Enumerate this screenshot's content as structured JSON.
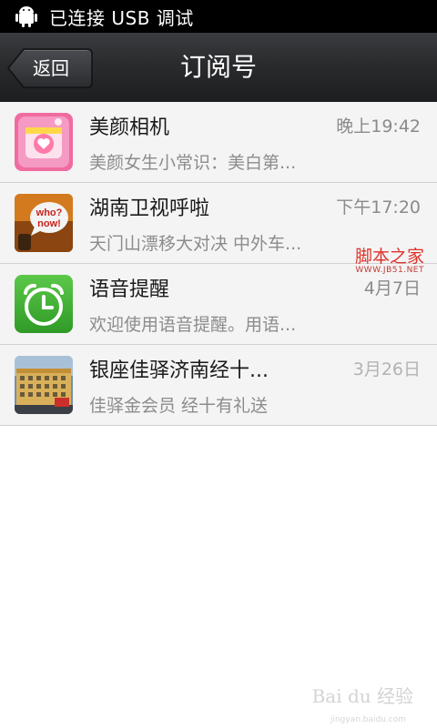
{
  "status_bar": {
    "text": "已连接 USB 调试",
    "icon": "android-debug-icon"
  },
  "header": {
    "back_label": "返回",
    "title": "订阅号"
  },
  "items": [
    {
      "name": "美颜相机",
      "time": "晚上19:42",
      "preview": "美颜女生小常识：美白第...",
      "icon": "camera-heart-app-icon"
    },
    {
      "name": "湖南卫视呼啦",
      "time": "下午17:20",
      "preview": "天门山漂移大对决 中外车...",
      "icon": "who-now-app-icon"
    },
    {
      "name": "语音提醒",
      "time": "4月7日",
      "preview": "欢迎使用语音提醒。用语...",
      "icon": "alarm-clock-app-icon"
    },
    {
      "name": "银座佳驿济南经十...",
      "time": "3月26日",
      "preview": "佳驿金会员 经十有礼送",
      "icon": "hotel-building-icon"
    }
  ],
  "watermark": {
    "line1": "脚本之家",
    "line2": "WWW.JB51.NET",
    "bottom": "Bai du 经验",
    "bottom_sub": "jingyan.baidu.com"
  }
}
